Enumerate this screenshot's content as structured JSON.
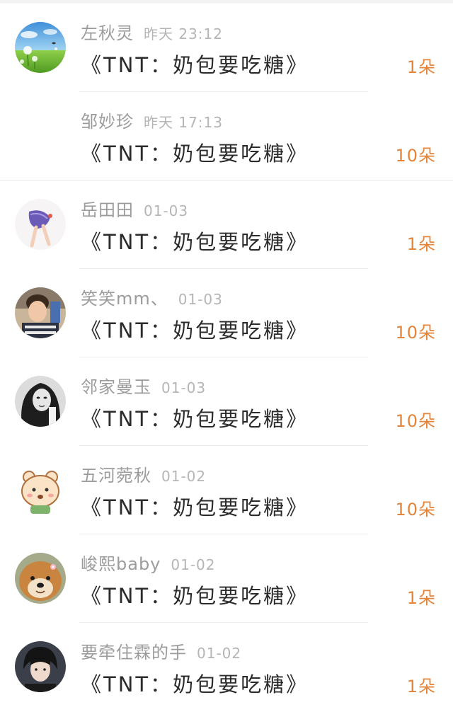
{
  "gift_records": [
    {
      "sender": "左秋灵",
      "time": "昨天 23:12",
      "book": "《TNT：奶包要吃糖》",
      "amount": "1朵",
      "avatar_icon": "dandelion-field-avatar"
    },
    {
      "sender": "邹妙珍",
      "time": "昨天 17:13",
      "book": "《TNT：奶包要吃糖》",
      "amount": "10朵",
      "avatar_icon": ""
    },
    {
      "sender": "岳田田",
      "time": "01-03",
      "book": "《TNT：奶包要吃糖》",
      "amount": "1朵",
      "avatar_icon": "dancer-illustration-avatar"
    },
    {
      "sender": "笑笑mm、",
      "time": "01-03",
      "book": "《TNT：奶包要吃糖》",
      "amount": "10朵",
      "avatar_icon": "boy-photo-avatar"
    },
    {
      "sender": "邻家曼玉",
      "time": "01-03",
      "book": "《TNT：奶包要吃糖》",
      "amount": "10朵",
      "avatar_icon": "bw-portrait-avatar"
    },
    {
      "sender": "五河菀秋",
      "time": "01-02",
      "book": "《TNT：奶包要吃糖》",
      "amount": "10朵",
      "avatar_icon": "cartoon-bear-avatar"
    },
    {
      "sender": "峻熙baby",
      "time": "01-02",
      "book": "《TNT：奶包要吃糖》",
      "amount": "1朵",
      "avatar_icon": "shiba-dog-avatar"
    },
    {
      "sender": "要牵住霖的手",
      "time": "01-02",
      "book": "《TNT：奶包要吃糖》",
      "amount": "1朵",
      "avatar_icon": "dark-hair-boy-avatar"
    }
  ],
  "colors": {
    "amount": "#e3853a",
    "sender": "#9c9c9c",
    "time": "#b5b5b5",
    "book": "#2b2b2b",
    "divider": "#ececec"
  }
}
